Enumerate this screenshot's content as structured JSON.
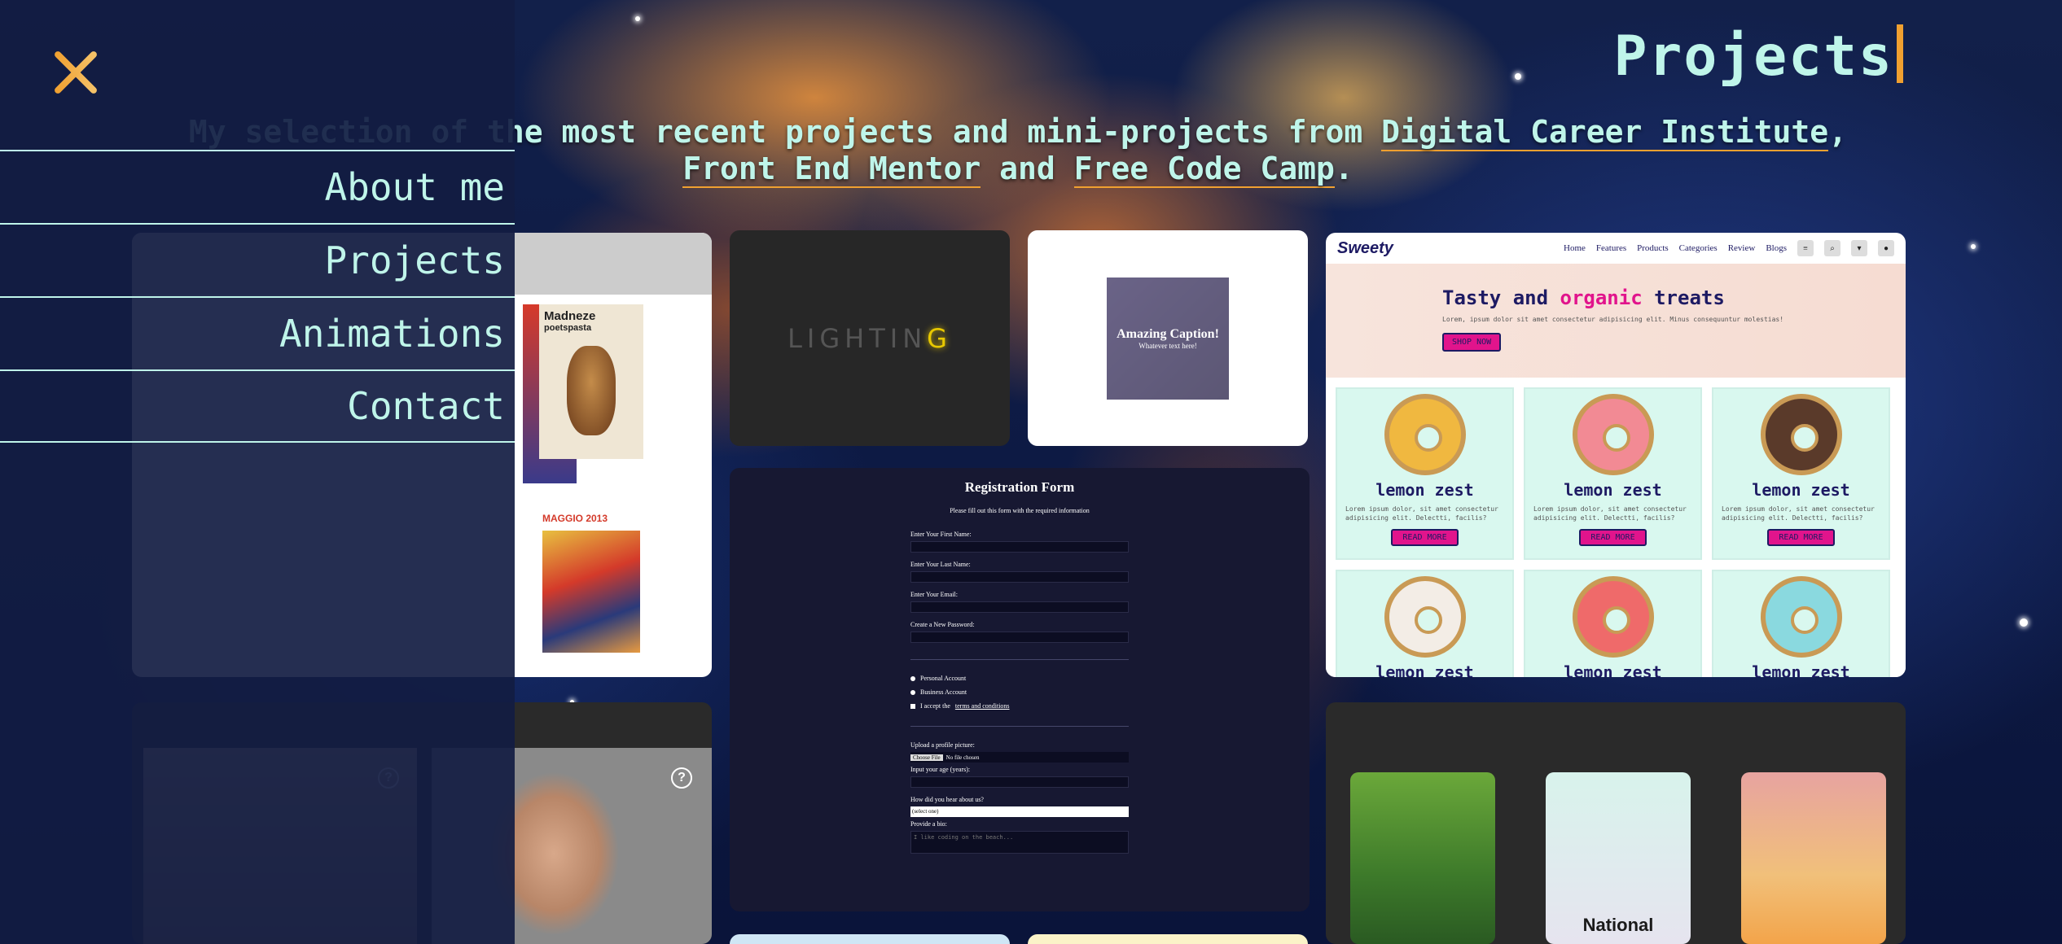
{
  "header": {
    "title": "Projects",
    "intro_prefix": "My selection of the most recent projects and mini-projects from ",
    "link_dci": "Digital Career Institute",
    "sep1": ",",
    "link_fem": "Front End Mentor",
    "and": " and ",
    "link_fcc": "Free Code Camp",
    "end": "."
  },
  "menu": {
    "close_icon": "close-icon",
    "items": [
      {
        "label": "About me"
      },
      {
        "label": "Projects"
      },
      {
        "label": "Animations"
      },
      {
        "label": "Contact"
      }
    ]
  },
  "poster": {
    "title_a": "Madneze",
    "subtitle_a": "poetspasta",
    "title_b": "MAGGIO 2013"
  },
  "lighting": {
    "text_main": "LIGHTIN",
    "text_hl": "G"
  },
  "caption": {
    "title": "Amazing Caption!",
    "subtitle": "Whatever text here!"
  },
  "sweety": {
    "logo": "Sweety",
    "nav": [
      "Home",
      "Features",
      "Products",
      "Categories",
      "Review",
      "Blogs"
    ],
    "hero_a": "Tasty and ",
    "hero_b": "organic",
    "hero_c": " treats",
    "hero_text": "Lorem, ipsum dolor sit amet consectetur adipisicing elit. Minus consequuntur molestias!",
    "hero_button": "SHOP NOW",
    "items": [
      {
        "name": "lemon zest",
        "text": "Lorem ipsum dolor, sit amet consectetur adipisicing elit. Delectti, facilis?",
        "button": "READ MORE",
        "color": "#f0b840"
      },
      {
        "name": "lemon zest",
        "text": "Lorem ipsum dolor, sit amet consectetur adipisicing elit. Delectti, facilis?",
        "button": "READ MORE",
        "color": "#f28a94"
      },
      {
        "name": "lemon zest",
        "text": "Lorem ipsum dolor, sit amet consectetur adipisicing elit. Delectti, facilis?",
        "button": "READ MORE",
        "color": "#5a3a2a"
      },
      {
        "name": "lemon zest",
        "color": "#f3ede6"
      },
      {
        "name": "lemon zest",
        "color": "#ef6a6a"
      },
      {
        "name": "lemon zest",
        "color": "#8ad9df"
      }
    ]
  },
  "form": {
    "title": "Registration Form",
    "desc": "Please fill out this form with the required information",
    "first": "Enter Your First Name:",
    "last": "Enter Your Last Name:",
    "email": "Enter Your Email:",
    "password": "Create a New Password:",
    "personal": "Personal Account",
    "business": "Business Account",
    "terms_a": "I accept the ",
    "terms_b": "terms and conditions",
    "upload": "Upload a profile picture:",
    "choose": "Choose File",
    "no_file": "No file chosen",
    "age": "Input your age (years):",
    "hear": "How did you hear about us?",
    "select": "(select one)",
    "bio": "Provide a bio:",
    "bio_placeholder": "I like coding on the beach..."
  },
  "parks": {
    "title": "National"
  },
  "colors": {
    "accent": "#f0a030",
    "text": "#bff5ea",
    "overlay": "#121c42"
  }
}
